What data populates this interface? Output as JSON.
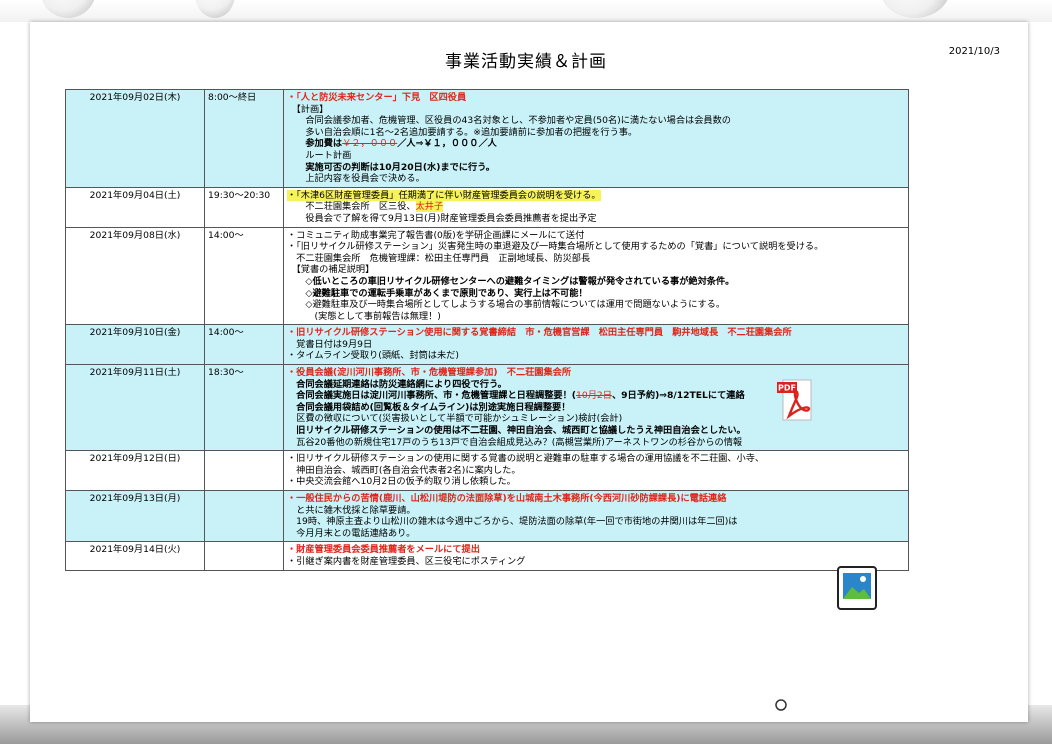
{
  "header": {
    "title": "事業活動実績＆計画",
    "date": "2021/10/3"
  },
  "rows": [
    {
      "date": "2021年09月02日(木)",
      "time": "8:00～終日",
      "cyan": true,
      "lines": [
        [
          {
            "t": "・",
            "s": "red"
          },
          {
            "t": "「人と防災未来センター」下見　区四役員",
            "s": "red"
          }
        ],
        [
          {
            "t": "　【計画】"
          }
        ],
        [
          {
            "t": "　　合同会議参加者、危機管理、区役員の43名対象とし、不参加者や定員(50名)に満たない場合は会員数の"
          }
        ],
        [
          {
            "t": "　　多い自治会順に1名～2名追加要請する。※追加要請前に参加者の把握を行う事。"
          }
        ],
        [
          {
            "t": "　　参加費は",
            "s": "bold"
          },
          {
            "t": "￥２，０００",
            "s": "redstrike"
          },
          {
            "t": "／人⇒￥１，０００／人",
            "s": "bold"
          }
        ],
        [
          {
            "t": "　　ルート計画"
          }
        ],
        [
          {
            "t": "　　実施可否の判断は10月20日(水)までに行う。",
            "s": "bold"
          }
        ],
        [
          {
            "t": "　　上記内容を役員会で決める。"
          }
        ]
      ]
    },
    {
      "date": "2021年09月04日(土)",
      "time": "19:30～20:30",
      "cyan": false,
      "lines": [
        [
          {
            "t": "・「木津6区財産管理委員」任期満了に伴い財産管理委員会の説明を受ける。",
            "s": "hl"
          }
        ],
        [
          {
            "t": "　　不二荘園集会所　区三役、"
          },
          {
            "t": "太井子",
            "s": "hlred"
          }
        ],
        [
          {
            "t": "　　役員会で了解を得て9月13日(月)財産管理委員会委員推薦者を提出予定"
          }
        ]
      ]
    },
    {
      "date": "2021年09月08日(水)",
      "time": "14:00～",
      "cyan": false,
      "lines": [
        [
          {
            "t": "・コミュニティ助成事業完了報告書(0版)を学研企画課にメールにて送付"
          }
        ],
        [
          {
            "t": "・「旧リサイクル研修ステーション」災害発生時の車退避及び一時集合場所として使用するための「覚書」について説明を受ける。"
          }
        ],
        [
          {
            "t": "　不二荘園集会所　危機管理課：松田主任専門員　正副地域長、防災部長"
          }
        ],
        [
          {
            "t": "　【覚書の補足説明】"
          }
        ],
        [
          {
            "t": "　　◇低いところの車旧リサイクル研修センターへの避難タイミングは",
            "s": "bold"
          },
          {
            "t": "警報が発令されている事が絶対条件。",
            "s": "bold"
          }
        ],
        [
          {
            "t": "　　◇避難駐車での運転手乗車があくまで原則であり、実行上は不可能！",
            "s": "bold"
          }
        ],
        [
          {
            "t": "　　◇避難駐車及び一時集合場所としてしようする場合の事前情報については運用で問題ないようにする。"
          }
        ],
        [
          {
            "t": "　　　(実態として事前報告は無理！)"
          }
        ]
      ]
    },
    {
      "date": "2021年09月10日(金)",
      "time": "14:00～",
      "cyan": true,
      "lines": [
        [
          {
            "t": "・旧リサイクル研修ステーション使用に関する覚書締結　市・危機官営課　松田主任専門員　駒井地域長　不二荘園集会所",
            "s": "red"
          }
        ],
        [
          {
            "t": "　覚書日付は9月9日"
          }
        ],
        [
          {
            "t": "・タイムライン受取り(頭紙、封筒は未だ)"
          }
        ]
      ]
    },
    {
      "date": "2021年09月11日(土)",
      "time": "18:30～",
      "cyan": true,
      "lines": [
        [
          {
            "t": "・役員会議(淀川河川事務所、市・危機管理課参加)　不二荘園集会所",
            "s": "red"
          }
        ],
        [
          {
            "t": "　合同会議延期連絡は防災連絡網により四役で行う。",
            "s": "bold"
          }
        ],
        [
          {
            "t": "　合同会議実施日は淀川河川事務所、市・危機管理課と日程調整要！(",
            "s": "bold"
          },
          {
            "t": "10月2日",
            "s": "redstrike"
          },
          {
            "t": "、9日予約)⇒8/12TELにて連絡",
            "s": "bold"
          }
        ],
        [
          {
            "t": "　合同会議用袋詰め(回覧板＆タイムライン)は別途実施日程調整要！",
            "s": "bold"
          }
        ],
        [
          {
            "t": "　区費の徴収について(災害扱いとして半額で可能かシュミレーション)検討(会計)"
          }
        ],
        [
          {
            "t": "　旧リサイクル研修ステーションの使用は不二荘園、神田自治会、城西町と協議したうえ神田自治会としたい。",
            "s": "bold"
          }
        ],
        [
          {
            "t": "　瓦谷20番他の新規住宅17戸のうち13戸で自治会組成見込み？(高槻営業所)アーネストワンの杉谷からの情報"
          }
        ]
      ]
    },
    {
      "date": "2021年09月12日(日)",
      "time": "",
      "cyan": false,
      "lines": [
        [
          {
            "t": "・旧リサイクル研修ステーションの使用に関する覚書の説明と避難車の駐車する場合の運用協議を不二荘園、小寺、"
          }
        ],
        [
          {
            "t": "　神田自治会、城西町(各自治会代表者2名)に案内した。"
          }
        ],
        [
          {
            "t": "・中央交流会館へ10月2日の仮予約取り消し依頼した。"
          }
        ]
      ]
    },
    {
      "date": "2021年09月13日(月)",
      "time": "",
      "cyan": true,
      "lines": [
        [
          {
            "t": "・一般住民からの苦情(鹿川、山松川堤防の法面除草)を山城南土木事務所(今西河川砂防課課長)に電話連絡",
            "s": "red"
          }
        ],
        [
          {
            "t": "　と共に雑木伐採と除草要請。"
          }
        ],
        [
          {
            "t": "　19時、神原主査より山松川の雑木は今週中ごろから、堤防法面の除草(年一回で市街地の井関川は年二回)は"
          }
        ],
        [
          {
            "t": "　今月月末との電話連絡あり。"
          }
        ]
      ]
    },
    {
      "date": "2021年09月14日(火)",
      "time": "",
      "cyan": false,
      "lines": [
        [
          {
            "t": "・財産管理委員会委員推薦者をメールにて提出",
            "s": "red"
          }
        ],
        [
          {
            "t": "・引継ぎ案内書を財産管理委員、区三役宅にポスティング"
          }
        ]
      ]
    }
  ],
  "icons": {
    "pdf": "pdf-document-icon",
    "image": "image-file-icon",
    "pdf_label": "PDF"
  }
}
